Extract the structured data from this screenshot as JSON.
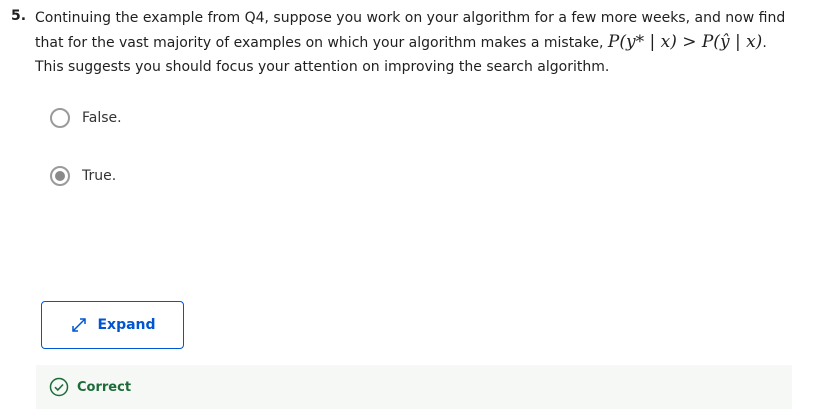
{
  "question": {
    "number": "5.",
    "text_before": "Continuing the example from Q4, suppose you work on your algorithm for a few more weeks, and now find that for the vast majority of examples on which your algorithm makes a mistake,",
    "math": "P(y* | x) > P(ŷ | x)",
    "text_after": ". This suggests you should focus your attention on improving the search algorithm."
  },
  "options": [
    {
      "label": "False.",
      "selected": false
    },
    {
      "label": "True.",
      "selected": true
    }
  ],
  "expand_button": {
    "label": "Expand",
    "icon": "expand-arrows-icon"
  },
  "feedback": {
    "label": "Correct",
    "icon": "check-circle-icon",
    "color": "#1e6b3a"
  },
  "colors": {
    "accent": "#0056d2",
    "success": "#1e6b3a"
  }
}
